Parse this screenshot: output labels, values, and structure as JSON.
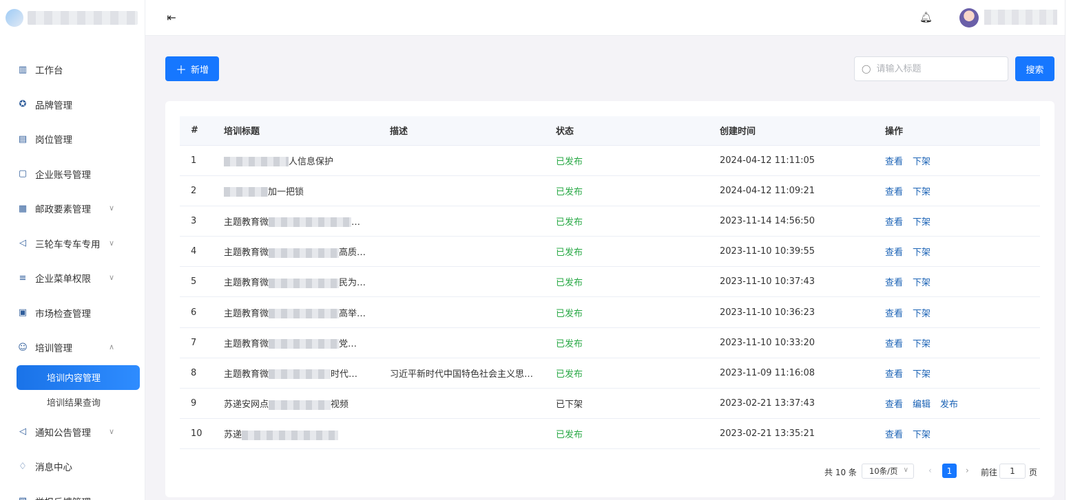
{
  "sidebar": {
    "items": [
      {
        "label": "工作台",
        "icon": "dashboard-icon",
        "glyph": "▥",
        "expandable": false
      },
      {
        "label": "品牌管理",
        "icon": "badge-icon",
        "glyph": "✪",
        "expandable": false
      },
      {
        "label": "岗位管理",
        "icon": "post-icon",
        "glyph": "▤",
        "expandable": false
      },
      {
        "label": "企业账号管理",
        "icon": "monitor-icon",
        "glyph": "▢",
        "expandable": false
      },
      {
        "label": "邮政要素管理",
        "icon": "document-icon",
        "glyph": "▦",
        "expandable": true
      },
      {
        "label": "三轮车专车专用",
        "icon": "megaphone-icon",
        "glyph": "◁",
        "expandable": true
      },
      {
        "label": "企业菜单权限",
        "icon": "sliders-icon",
        "glyph": "≡",
        "expandable": true
      },
      {
        "label": "市场检查管理",
        "icon": "checklist-icon",
        "glyph": "▣",
        "expandable": false
      },
      {
        "label": "培训管理",
        "icon": "training-icon",
        "glyph": "☺",
        "expandable": true,
        "expanded": true
      }
    ],
    "sub_items": [
      {
        "label": "培训内容管理",
        "active": true
      },
      {
        "label": "培训结果查询",
        "active": false
      }
    ],
    "items_after": [
      {
        "label": "通知公告管理",
        "icon": "megaphone-icon",
        "glyph": "◁",
        "expandable": true
      },
      {
        "label": "消息中心",
        "icon": "bell-icon",
        "glyph": "♢",
        "expandable": false
      },
      {
        "label": "举报反馈管理",
        "icon": "report-icon",
        "glyph": "▧",
        "expandable": false
      }
    ]
  },
  "toolbar": {
    "add_label": "新增",
    "search_placeholder": "请输入标题",
    "search_value": "",
    "search_label": "搜索"
  },
  "table": {
    "headers": [
      "#",
      "培训标题",
      "描述",
      "状态",
      "创建时间",
      "操作"
    ],
    "rows": [
      {
        "idx": "1",
        "title_prefix": "",
        "blur": 94,
        "title_suffix": "人信息保护",
        "desc": "",
        "status": "已发布",
        "published": true,
        "time": "2024-04-12 11:11:05",
        "ops": [
          "查看",
          "下架"
        ]
      },
      {
        "idx": "2",
        "title_prefix": "",
        "blur": 64,
        "title_suffix": "加一把锁",
        "desc": "",
        "status": "已发布",
        "published": true,
        "time": "2024-04-12 11:09:21",
        "ops": [
          "查看",
          "下架"
        ]
      },
      {
        "idx": "3",
        "title_prefix": "主题教育微",
        "blur": 120,
        "title_suffix": "…",
        "desc": "",
        "status": "已发布",
        "published": true,
        "time": "2023-11-14 14:56:50",
        "ops": [
          "查看",
          "下架"
        ]
      },
      {
        "idx": "4",
        "title_prefix": "主题教育微",
        "blur": 102,
        "title_suffix": "高质…",
        "desc": "",
        "status": "已发布",
        "published": true,
        "time": "2023-11-10 10:39:55",
        "ops": [
          "查看",
          "下架"
        ]
      },
      {
        "idx": "5",
        "title_prefix": "主题教育微",
        "blur": 102,
        "title_suffix": "民为…",
        "desc": "",
        "status": "已发布",
        "published": true,
        "time": "2023-11-10 10:37:43",
        "ops": [
          "查看",
          "下架"
        ]
      },
      {
        "idx": "6",
        "title_prefix": "主题教育微",
        "blur": 102,
        "title_suffix": "高举…",
        "desc": "",
        "status": "已发布",
        "published": true,
        "time": "2023-11-10 10:36:23",
        "ops": [
          "查看",
          "下架"
        ]
      },
      {
        "idx": "7",
        "title_prefix": "主题教育微",
        "blur": 102,
        "title_suffix": "党…",
        "desc": "",
        "status": "已发布",
        "published": true,
        "time": "2023-11-10 10:33:20",
        "ops": [
          "查看",
          "下架"
        ]
      },
      {
        "idx": "8",
        "title_prefix": "主题教育微",
        "blur": 90,
        "title_suffix": "时代…",
        "desc": "习近平新时代中国特色社会主义思…",
        "status": "已发布",
        "published": true,
        "time": "2023-11-09 11:16:08",
        "ops": [
          "查看",
          "下架"
        ]
      },
      {
        "idx": "9",
        "title_prefix": "苏递安网点",
        "blur": 90,
        "title_suffix": "视频",
        "desc": "",
        "status": "已下架",
        "published": false,
        "time": "2023-02-21 13:37:43",
        "ops": [
          "查看",
          "编辑",
          "发布"
        ]
      },
      {
        "idx": "10",
        "title_prefix": "苏递",
        "blur": 140,
        "title_suffix": "",
        "desc": "",
        "status": "已发布",
        "published": true,
        "time": "2023-02-21 13:35:21",
        "ops": [
          "查看",
          "下架"
        ]
      }
    ]
  },
  "pagination": {
    "total_label": "共 10 条",
    "page_size_label": "10条/页",
    "current_page": "1",
    "goto_prefix": "前往",
    "goto_value": "1",
    "goto_suffix": "页"
  },
  "colors": {
    "primary": "#1677ff",
    "published": "#27a844",
    "link": "#1a62b5"
  }
}
